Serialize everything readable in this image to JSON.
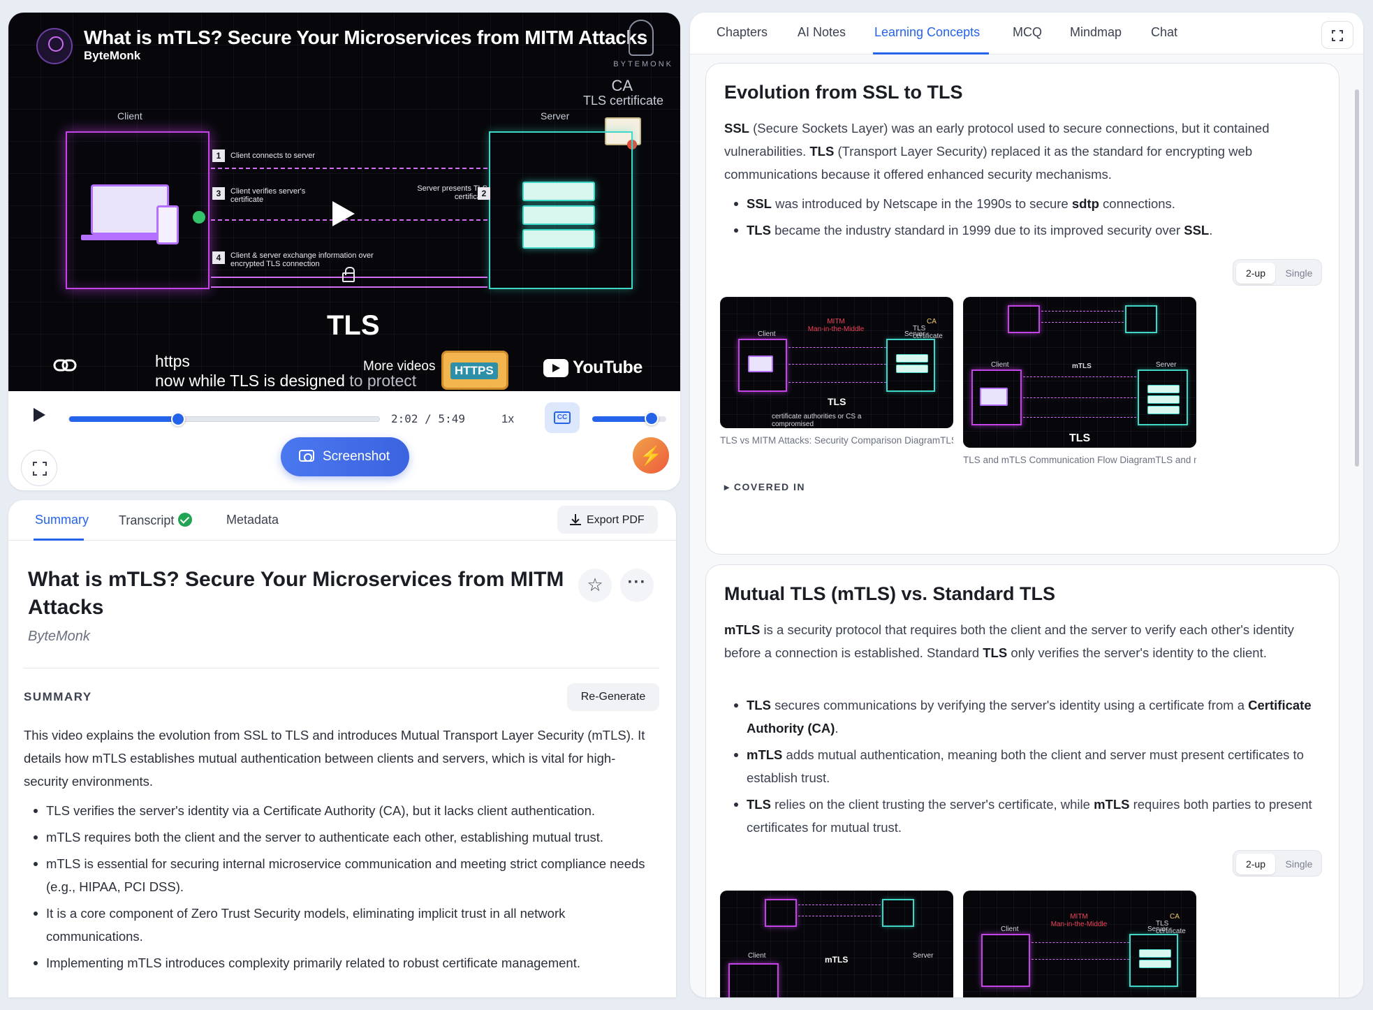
{
  "video": {
    "title": "What is mTLS? Secure Your Microservices from MITM Attacks",
    "channel": "ByteMonk",
    "brand": "BYTEMONK",
    "ca_label": "CA",
    "ca_sublabel": "TLS certificate",
    "client_label": "Client",
    "server_label": "Server",
    "steps": [
      {
        "num": "1",
        "text": "Client connects to server"
      },
      {
        "num": "2",
        "text": "Server presents TLS certificate"
      },
      {
        "num": "3",
        "text": "Client verifies server's certificate"
      },
      {
        "num": "4",
        "text": "Client & server exchange information over encrypted TLS connection"
      }
    ],
    "center_label": "TLS",
    "caption_line1": "https",
    "caption_line2a": "now while TLS is designed",
    "caption_line2b": "to protect",
    "more_videos": "More videos",
    "https_badge": "HTTPS",
    "youtube": "YouTube"
  },
  "player": {
    "time": "2:02 / 5:49",
    "speed": "1x",
    "progress": 0.35,
    "volume": 0.8,
    "cc_label": "CC",
    "screenshot_label": "Screenshot",
    "bolt_icon": "⚡"
  },
  "summary_panel": {
    "tabs": [
      {
        "label": "Summary",
        "active": true
      },
      {
        "label": "Transcript",
        "active": false
      },
      {
        "label": "Metadata",
        "active": false
      }
    ],
    "export_label": "Export PDF",
    "title": "What is mTLS? Secure Your Microservices from MITM Attacks",
    "author": "ByteMonk",
    "star_icon": "☆",
    "more_icon": "···",
    "section_heading": "SUMMARY",
    "regenerate_label": "Re-Generate",
    "paragraph": "This video explains the evolution from SSL to TLS and introduces Mutual Transport Layer Security (mTLS). It details how mTLS establishes mutual authentication between clients and servers, which is vital for high-security environments.",
    "bullets": [
      "TLS verifies the server's identity via a Certificate Authority (CA), but it lacks client authentication.",
      "mTLS requires both the client and the server to authenticate each other, establishing mutual trust.",
      "mTLS is essential for securing internal microservice communication and meeting strict compliance needs (e.g., HIPAA, PCI DSS).",
      "It is a core component of Zero Trust Security models, eliminating implicit trust in all network communications.",
      "Implementing mTLS introduces complexity primarily related to robust certificate management."
    ]
  },
  "right_panel": {
    "tabs": [
      {
        "label": "Chapters",
        "active": false
      },
      {
        "label": "AI Notes",
        "active": false
      },
      {
        "label": "Learning Concepts",
        "active": true
      },
      {
        "label": "MCQ",
        "active": false
      },
      {
        "label": "Mindmap",
        "active": false
      },
      {
        "label": "Chat",
        "active": false
      }
    ],
    "toggle_on": "2-up",
    "toggle_off": "Single",
    "concept1": {
      "title": "Evolution from SSL to TLS",
      "para_parts": [
        "SSL",
        " (Secure Sockets Layer) was an early protocol used to secure connections, but it contained vulnerabilities. ",
        "TLS",
        " (Transport Layer Security) replaced it as the standard for encrypting web communications because it offered enhanced security mechanisms."
      ],
      "bullet1": [
        "SSL",
        " was introduced by Netscape in the 1990s to secure ",
        "sdtp",
        " connections."
      ],
      "bullet2": [
        "TLS",
        " became the industry standard in 1999 due to its improved security over ",
        "SSL",
        "."
      ],
      "thumb1_caption": "TLS vs MITM Attacks: Security Comparison DiagramTLS vs ...",
      "thumb2_caption": "TLS and mTLS Communication Flow DiagramTLS and mTLS...",
      "covered_label": "▸ COVERED IN",
      "thumb1": {
        "red1": "MITM",
        "red2": "Man-in-the-Middle",
        "ca": "CA",
        "ca_sub": "TLS certificate",
        "client": "Client",
        "server": "Server",
        "center": "TLS",
        "caption": "certificate authorities or CS a compromised"
      },
      "thumb2": {
        "top_label": "mTLS",
        "center": "TLS",
        "client": "Client",
        "server": "Server"
      }
    },
    "concept2": {
      "title": "Mutual TLS (mTLS) vs. Standard TLS",
      "para_parts": [
        "mTLS",
        " is a security protocol that requires both the client and the server to verify each other's identity before a connection is established. Standard ",
        "TLS",
        " only verifies the server's identity to the client."
      ],
      "bullet1": [
        "TLS",
        " secures communications by verifying the server's identity using a certificate from a ",
        "Certificate Authority (CA)",
        "."
      ],
      "bullet2": [
        "mTLS",
        " adds mutual authentication, meaning both the client and server must present certificates to establish trust."
      ],
      "bullet3": [
        "TLS",
        " relies on the client trusting the server's certificate, while ",
        "mTLS",
        " requires both parties to present certificates for mutual trust."
      ],
      "thumb3": {
        "center": "mTLS",
        "client": "Client",
        "server": "Server"
      },
      "thumb4": {
        "red1": "MITM",
        "red2": "Man-in-the-Middle",
        "ca": "CA",
        "ca_sub": "TLS certificate",
        "client": "Client",
        "server": "Server"
      }
    }
  },
  "colors": {
    "accent": "#2563eb",
    "neon_purple": "#c444e8",
    "neon_teal": "#3fd8c8",
    "success": "#22a455",
    "bolt_orange": "#ee5b3b"
  }
}
